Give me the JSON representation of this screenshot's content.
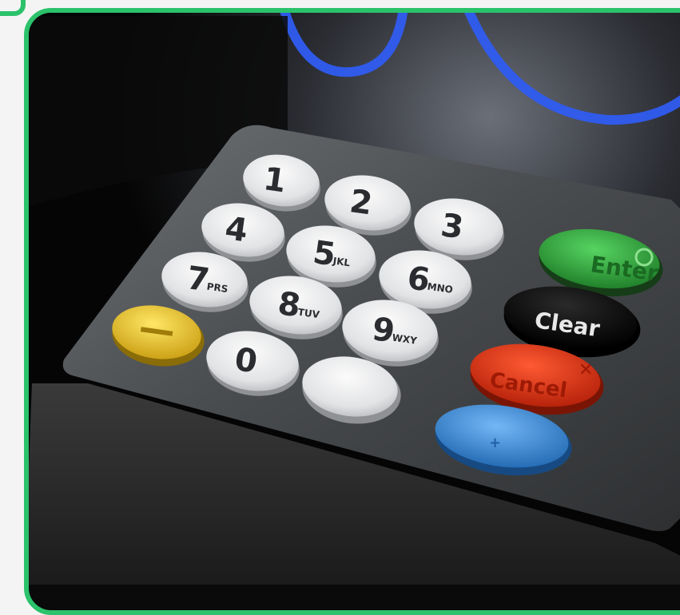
{
  "keypad": {
    "digits": [
      {
        "num": "1",
        "sub": ""
      },
      {
        "num": "2",
        "sub": ""
      },
      {
        "num": "3",
        "sub": ""
      },
      {
        "num": "4",
        "sub": ""
      },
      {
        "num": "5",
        "sub": "JKL"
      },
      {
        "num": "6",
        "sub": "MNO"
      },
      {
        "num": "7",
        "sub": "PRS"
      },
      {
        "num": "8",
        "sub": "TUV"
      },
      {
        "num": "9",
        "sub": "WXY"
      },
      {
        "num": "0",
        "sub": ""
      }
    ],
    "enter_label": "Enter",
    "clear_label": "Clear",
    "cancel_label": "Cancel"
  },
  "colors": {
    "frame": "#2bc26b",
    "enter": "#2fa83d",
    "clear": "#0d0d0d",
    "cancel": "#e4381c",
    "yellow": "#e8c52a",
    "blue": "#3a8fdc",
    "ring": "#2f5cf0"
  }
}
